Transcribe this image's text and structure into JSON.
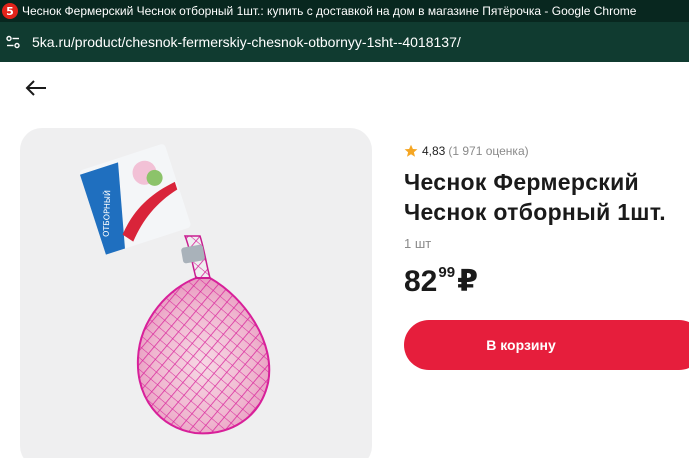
{
  "browser": {
    "favicon_glyph": "5",
    "window_title": "Чеснок Фермерский Чеснок отборный 1шт.: купить с доставкой на дом в магазине Пятёрочка - Google Chrome",
    "url": "5ka.ru/product/chesnok-fermerskiy-chesnok-otbornyy-1sht--4018137/"
  },
  "product": {
    "rating_value": "4,83",
    "rating_count": "(1 971 оценка)",
    "title_line1": "Чеснок Фермерский",
    "title_line2": "Чеснок отборный 1шт.",
    "unit": "1 шт",
    "price_rub": "82",
    "price_kop": "99",
    "currency": "₽",
    "add_to_cart_label": "В корзину",
    "package_label_text": "ОТБОРНЫЙ"
  },
  "colors": {
    "title_bar_bg": "#08271f",
    "address_bar_bg": "#103b30",
    "accent_red": "#e61e3c",
    "star": "#f5a623",
    "net_pink": "#e0379e"
  },
  "icons": {
    "site_info": "tune-icon",
    "back": "arrow-left-icon",
    "rating": "star-icon"
  }
}
